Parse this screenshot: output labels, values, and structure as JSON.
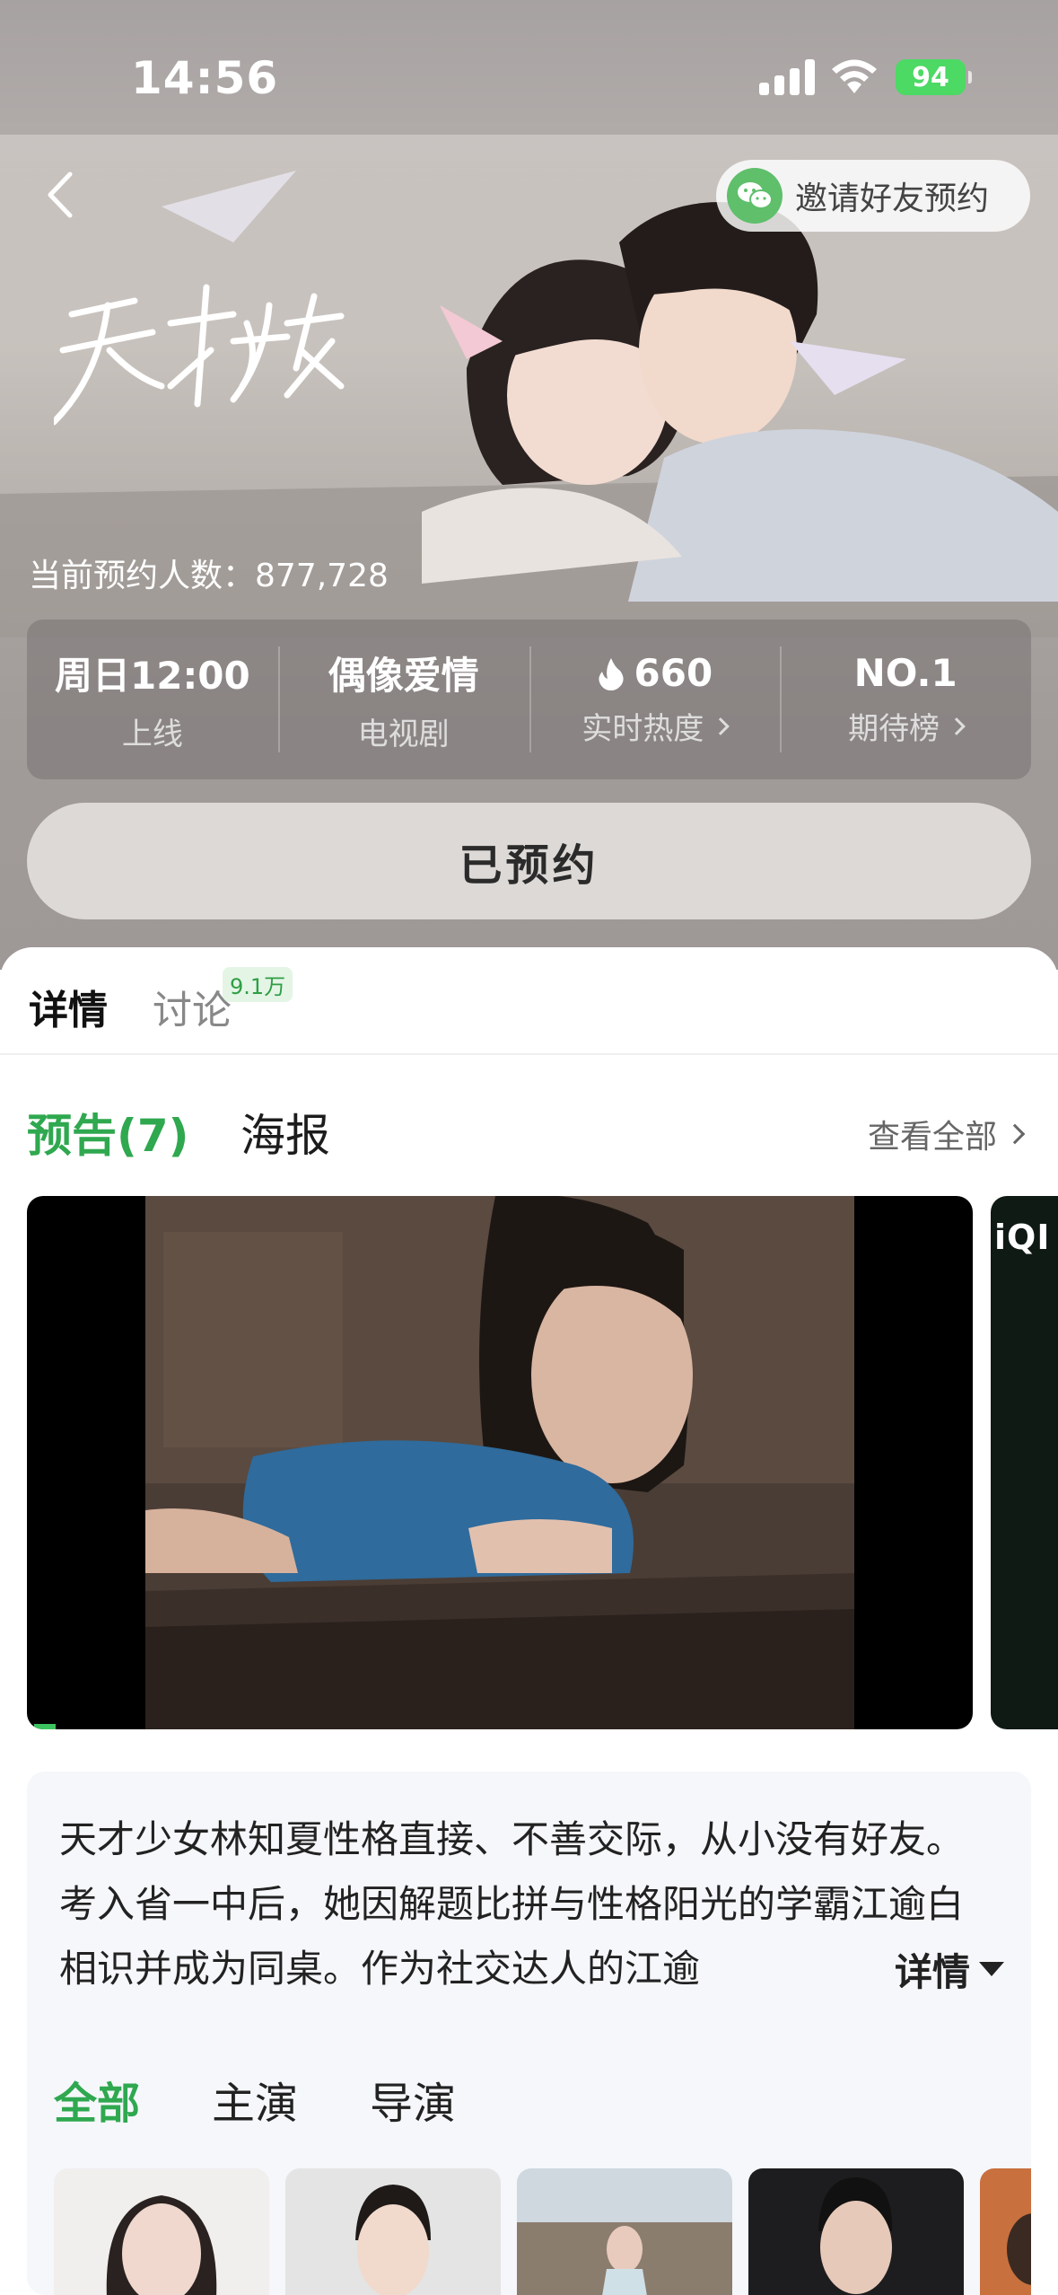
{
  "status_bar": {
    "time": "14:56",
    "battery": "94"
  },
  "header": {
    "invite_label": "邀请好友预约",
    "reserve_count_label": "当前预约人数：",
    "reserve_count": "877,728"
  },
  "stats": [
    {
      "value": "周日12:00",
      "label": "上线"
    },
    {
      "value": "偶像爱情",
      "label": "电视剧"
    },
    {
      "value": "660",
      "label": "实时热度"
    },
    {
      "value": "NO.1",
      "label": "期待榜"
    }
  ],
  "reserved_button": "已预约",
  "tabs": {
    "detail": "详情",
    "discuss": "讨论",
    "discuss_badge": "9.1万"
  },
  "media": {
    "trailer_label": "预告(7)",
    "poster_label": "海报",
    "view_all": "查看全部",
    "next_logo": "iQI"
  },
  "synopsis": {
    "text": "天才少女林知夏性格直接、不善交际，从小没有好友。考入省一中后，她因解题比拼与性格阳光的学霸江逾白相识并成为同桌。作为社交达人的江逾",
    "toggle": "详情"
  },
  "cast_tabs": [
    "全部",
    "主演",
    "导演"
  ],
  "colors": {
    "accent_green": "#2fa84f",
    "battery_green": "#4cd964",
    "wechat_green": "#5fbf6b"
  }
}
